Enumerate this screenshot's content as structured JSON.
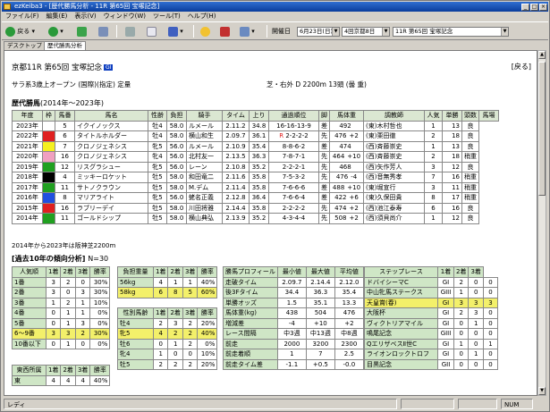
{
  "window": {
    "title": "ezKeiba3 - [歴代勝馬分析 - 11R 第65回 宝塚記念]"
  },
  "menu": [
    "ファイル(F)",
    "編集(E)",
    "表示(V)",
    "ウィンドウ(W)",
    "ツール(T)",
    "ヘルプ(H)"
  ],
  "toolbar": {
    "back": "戻る",
    "kaisai_label": "開催日",
    "date": "6月23日(日)",
    "track": "4回京都8日",
    "race": "11R 第65回 宝塚記念"
  },
  "tabs": [
    "デスクトップ",
    "歴代勝馬分析"
  ],
  "race": {
    "header": "京都11R 第65回 宝塚記念",
    "grade": "GI",
    "back": "[戻る]",
    "conditions": "サラ系3歳上オープン (国際)(指定) 定量",
    "course": "芝・右外 D 2200m 13頭 (曇 重)"
  },
  "history": {
    "title": "歴代勝馬",
    "period": "(2014年～2023年)",
    "headers": [
      "年度",
      "枠",
      "馬番",
      "馬名",
      "性齢",
      "負担",
      "騎手",
      "タイム",
      "上り",
      "通過順位",
      "脚",
      "馬体重",
      "調教師",
      "人気",
      "単勝",
      "頭数",
      "馬場"
    ],
    "rows": [
      [
        "2023年",
        "1",
        "5",
        "イクイノックス",
        "牡4",
        "58.0",
        "ルメール",
        "2.11.2",
        "34.8",
        "16-16-13-9",
        "差",
        "492",
        "",
        "(東)木村哲也",
        "1",
        "13",
        "良"
      ],
      [
        "2022年",
        "3",
        "6",
        "タイトルホルダー",
        "牡4",
        "58.0",
        "横山和生",
        "2.09.7",
        "36.1",
        "2-2-2-2",
        "先",
        "476",
        "+2",
        "(東)栗田徹",
        "2",
        "18",
        "良"
      ],
      [
        "2021年",
        "5",
        "7",
        "クロノジェネシス",
        "牝5",
        "56.0",
        "ルメール",
        "2.10.9",
        "35.4",
        "8-8-6-2",
        "差",
        "474",
        "",
        "(西)斉藤崇史",
        "1",
        "13",
        "良"
      ],
      [
        "2020年",
        "10",
        "16",
        "クロノジェネシス",
        "牝4",
        "56.0",
        "北村友一",
        "2.13.5",
        "36.3",
        "7-8-7-1",
        "先",
        "464",
        "+10",
        "(西)斉藤崇史",
        "2",
        "18",
        "稍重"
      ],
      [
        "2019年",
        "12",
        "12",
        "リスグラシュー",
        "牝5",
        "56.0",
        "レーン",
        "2.10.8",
        "35.2",
        "2-2-2-1",
        "先",
        "468",
        "",
        "(西)矢作芳人",
        "3",
        "12",
        "良"
      ],
      [
        "2018年",
        "2",
        "4",
        "ミッキーロケット",
        "牡5",
        "58.0",
        "和田竜二",
        "2.11.6",
        "35.8",
        "7-5-3-2",
        "先",
        "476",
        "-4",
        "(西)音無秀孝",
        "7",
        "16",
        "稍重"
      ],
      [
        "2017年",
        "11",
        "11",
        "サトノクラウン",
        "牡5",
        "58.0",
        "M.デム",
        "2.11.4",
        "35.8",
        "7-6-6-6",
        "差",
        "488",
        "+10",
        "(東)堀宣行",
        "3",
        "11",
        "稍重"
      ],
      [
        "2016年",
        "8",
        "8",
        "マリアライト",
        "牝5",
        "56.0",
        "蛯名正義",
        "2.12.8",
        "36.4",
        "7-6-6-4",
        "差",
        "422",
        "+6",
        "(東)久保田貴",
        "8",
        "17",
        "稍重"
      ],
      [
        "2015年",
        "6",
        "16",
        "ラブリーデイ",
        "牡5",
        "58.0",
        "川田将雅",
        "2.14.4",
        "35.8",
        "2-2-2-2",
        "先",
        "474",
        "+2",
        "(西)池江泰寿",
        "6",
        "16",
        "良"
      ],
      [
        "2014年",
        "11",
        "11",
        "ゴールドシップ",
        "牡5",
        "58.0",
        "横山典弘",
        "2.13.9",
        "35.2",
        "4-3-4-4",
        "先",
        "508",
        "+2",
        "(西)須貝尚介",
        "1",
        "12",
        "良"
      ]
    ],
    "note": "2014年から2023年は阪神芝2200m"
  },
  "trend": {
    "title": "[過去10年の傾向分析]",
    "n": "N=30",
    "pop": {
      "headers": [
        "人気順",
        "1着",
        "2着",
        "3着",
        "勝率"
      ],
      "rows": [
        [
          "1番",
          "3",
          "2",
          "0",
          "30%"
        ],
        [
          "2番",
          "3",
          "0",
          "3",
          "30%"
        ],
        [
          "3番",
          "1",
          "2",
          "1",
          "10%"
        ],
        [
          "4番",
          "0",
          "1",
          "1",
          "0%"
        ],
        [
          "5番",
          "0",
          "1",
          "3",
          "0%"
        ],
        [
          "6〜9番",
          "3",
          "3",
          "2",
          "30%"
        ],
        [
          "10番以下",
          "0",
          "1",
          "0",
          "0%"
        ]
      ]
    },
    "region": {
      "headers": [
        "東西所属",
        "1着",
        "2着",
        "3着",
        "勝率"
      ],
      "rows": [
        [
          "東",
          "4",
          "4",
          "4",
          "40%"
        ]
      ]
    },
    "weight": {
      "headers": [
        "負担重量",
        "1着",
        "2着",
        "3着",
        "勝率"
      ],
      "rows": [
        [
          "56kg",
          "4",
          "1",
          "1",
          "40%"
        ],
        [
          "58kg",
          "6",
          "8",
          "5",
          "60%"
        ]
      ]
    },
    "sex": {
      "headers": [
        "性別馬齢",
        "1着",
        "2着",
        "3着",
        "勝率"
      ],
      "rows": [
        [
          "牡4",
          "2",
          "3",
          "2",
          "20%"
        ],
        [
          "牝5",
          "4",
          "2",
          "2",
          "40%"
        ],
        [
          "牡6",
          "0",
          "1",
          "2",
          "0%"
        ],
        [
          "牝4",
          "1",
          "0",
          "0",
          "10%"
        ],
        [
          "牡5",
          "2",
          "2",
          "2",
          "20%"
        ]
      ]
    },
    "profile": {
      "headers": [
        "勝馬プロフィール",
        "最小値",
        "最大値",
        "平均値"
      ],
      "rows": [
        [
          "走破タイム",
          "2.09.7",
          "2.14.4",
          "2.12.0"
        ],
        [
          "後3Fタイム",
          "34.4",
          "36.3",
          "35.4"
        ],
        [
          "単勝オッズ",
          "1.5",
          "35.1",
          "13.3"
        ],
        [
          "馬体重(kg)",
          "438",
          "504",
          "476"
        ],
        [
          "増減差",
          "-4",
          "+10",
          "+2"
        ],
        [
          "レース間隔",
          "中3週",
          "中13週",
          "中8週"
        ],
        [
          "前走",
          "2000",
          "3200",
          "2300"
        ],
        [
          "前走着順",
          "1",
          "7",
          "2.5"
        ],
        [
          "前走タイム差",
          "-1.1",
          "+0.5",
          "-0.0"
        ]
      ]
    },
    "prerace": {
      "headers": [
        "ステップレース",
        "1着",
        "2着",
        "3着"
      ],
      "rows": [
        [
          "ドバイシーマC",
          "GI",
          "2",
          "0",
          "0"
        ],
        [
          "中山牝馬ステークス",
          "GIII",
          "1",
          "0",
          "0"
        ],
        [
          "天皇賞(春)",
          "GI",
          "3",
          "3",
          "3"
        ],
        [
          "大阪杯",
          "GI",
          "2",
          "3",
          "0"
        ],
        [
          "ヴィクトリアマイル",
          "GI",
          "0",
          "1",
          "0"
        ],
        [
          "鳴尾記念",
          "GIII",
          "0",
          "0",
          "0"
        ],
        [
          "QエリザベスⅡ世C",
          "GI",
          "1",
          "0",
          "1"
        ],
        [
          "ライオンロックトロフ",
          "GI",
          "0",
          "1",
          "0"
        ],
        [
          "目黒記念",
          "GII",
          "0",
          "0",
          "0"
        ]
      ]
    }
  },
  "status": {
    "ready": "レディ",
    "num": "NUM"
  },
  "colors": {
    "frame1": "#ffffff",
    "frame2": "#000000",
    "frame3": "#e02020",
    "frame4": "#2050e0",
    "frame5": "#f5f020",
    "frame6": "#20a020",
    "frame7": "#f08020",
    "frame8": "#f0a0c0",
    "header_bg": "#dbe7d2",
    "highlight": "#f3f06a"
  }
}
